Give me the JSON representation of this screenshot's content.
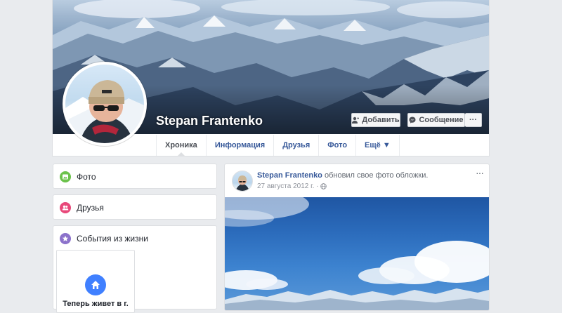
{
  "profile": {
    "name": "Stepan Frantenko",
    "add_friend_label": "Добавить",
    "message_label": "Сообщение",
    "more_label": "···"
  },
  "tabs": [
    {
      "label": "Хроника",
      "active": true
    },
    {
      "label": "Информация",
      "active": false
    },
    {
      "label": "Друзья",
      "active": false
    },
    {
      "label": "Фото",
      "active": false
    },
    {
      "label": "Ещё ▼",
      "active": false
    }
  ],
  "sidebar": {
    "photos": {
      "label": "Фото",
      "icon": "photo-icon",
      "color": "#6bc24b"
    },
    "friends": {
      "label": "Друзья",
      "icon": "friends-icon",
      "color": "#e8487a"
    },
    "life_events": {
      "label": "События из жизни",
      "icon": "life-event-icon",
      "color": "#8c72cb",
      "tile": {
        "text": "Теперь живет в г.",
        "icon": "home-icon",
        "color": "#4080ff"
      }
    }
  },
  "post": {
    "author": "Stepan Frantenko",
    "action": " обновил свое фото обложки.",
    "date": "27 августа 2012 г. ·",
    "privacy_icon": "globe-icon",
    "options_label": "···"
  },
  "colors": {
    "link": "#365899",
    "background": "#e9ebee",
    "border": "#dddfe2"
  }
}
